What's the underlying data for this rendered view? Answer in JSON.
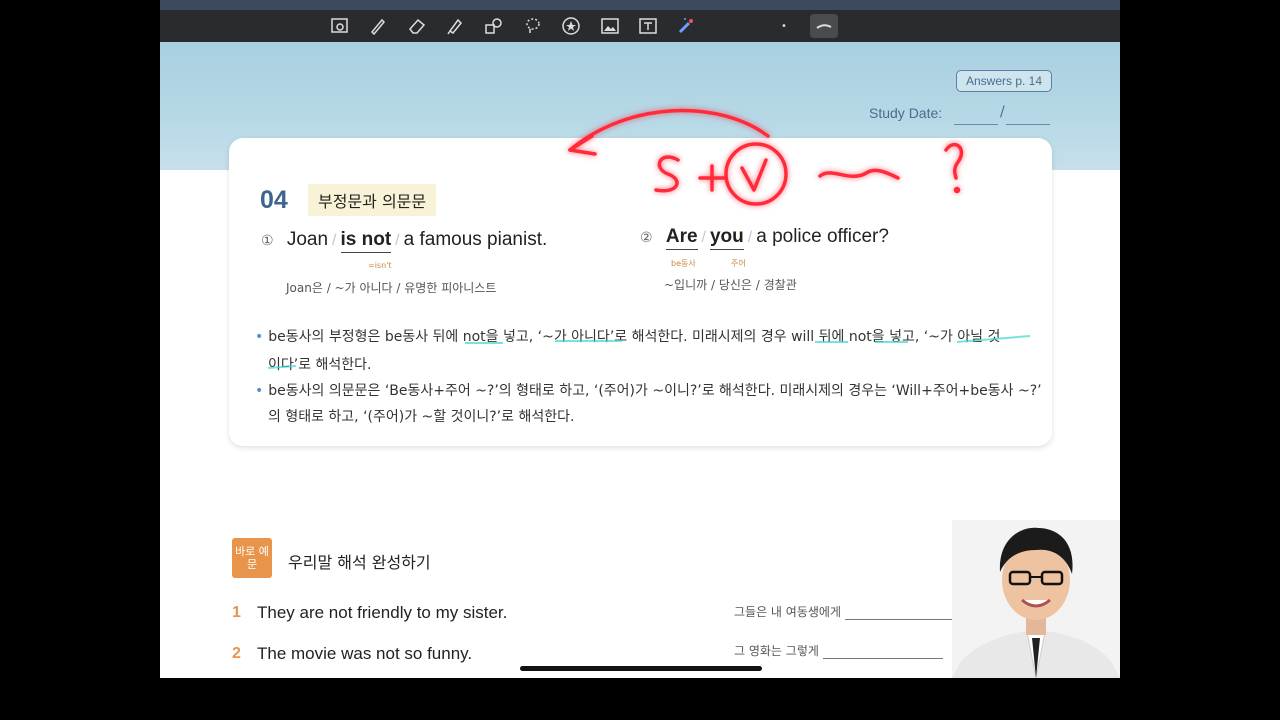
{
  "toolbar": {
    "tools": [
      "zoom-icon",
      "pen-icon",
      "eraser-icon",
      "highlighter-icon",
      "shapes-icon",
      "lasso-icon",
      "sticker-icon",
      "image-icon",
      "text-icon",
      "laser-icon"
    ],
    "dot_label": "•"
  },
  "header": {
    "answers_label": "Answers p. 14",
    "study_date_label": "Study Date:",
    "date_separator": "/"
  },
  "section": {
    "number": "04",
    "title": "부정문과 의문문"
  },
  "example1": {
    "marker": "①",
    "subject": "Joan",
    "verb": "is not",
    "verb_note": "=isn't",
    "rest": "a famous pianist.",
    "gloss": "Joan은 / ~가 아니다 / 유명한 피아니스트"
  },
  "example2": {
    "marker": "②",
    "verb": "Are",
    "verb_note": "be동사",
    "subject": "you",
    "subject_note": "주어",
    "rest": "a police officer?",
    "gloss": "~입니까 / 당신은 / 경찰관"
  },
  "bullets": {
    "b1_line1": "be동사의 부정형은 be동사 뒤에 not을 넣고, ‘~가 아니다’로 해석한다. 미래시제의 경우 will 뒤에 not을 넣고, ‘~가 아닐 것",
    "b1_line2": "이다’로 해석한다.",
    "b2_line1": "be동사의 의문문은 ‘Be동사+주어 ~?’의 형태로 하고, ‘(주어)가 ~이니?’로 해석한다. 미래시제의 경우는 ‘Will+주어+be동사 ~?’",
    "b2_line2": "의 형태로 하고, ‘(주어)가 ~할 것이니?’로 해석한다."
  },
  "practice": {
    "badge": "바로 예문",
    "title": "우리말 해석 완성하기",
    "rows": [
      {
        "num": "1",
        "text": "They are not friendly to my sister.",
        "kor": "그들은 내 여동생에게",
        "end": "."
      },
      {
        "num": "2",
        "text": "The movie was not so funny.",
        "kor": "그 영화는 그렇게",
        "end": ""
      }
    ]
  },
  "annotation": {
    "formula": "S+V ~ ?"
  },
  "colors": {
    "accent_blue": "#3d6590",
    "accent_orange": "#e8944a",
    "ink_red": "#ff2a3a"
  }
}
